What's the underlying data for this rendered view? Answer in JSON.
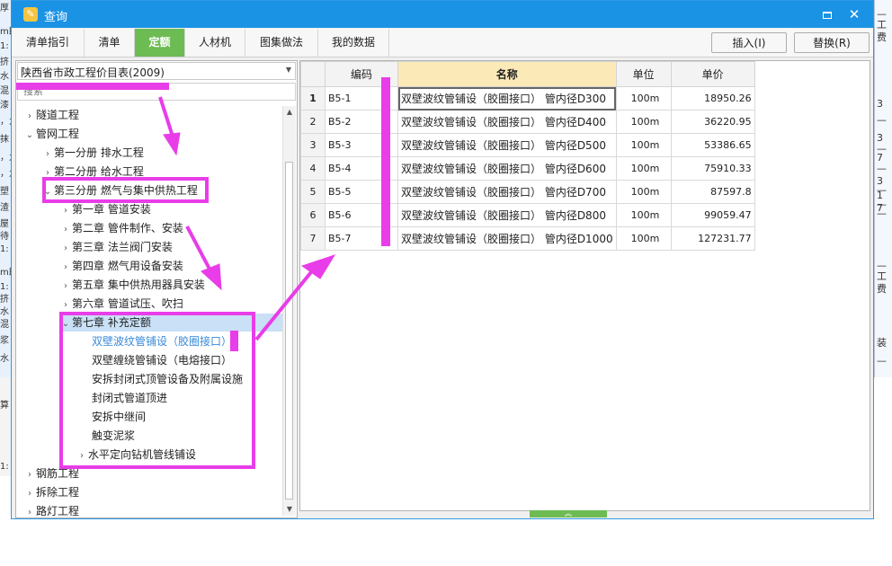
{
  "window": {
    "title": "查询",
    "minimize_label": "",
    "close_label": "✕"
  },
  "tabs": [
    {
      "label": "清单指引",
      "active": false
    },
    {
      "label": "清单",
      "active": false
    },
    {
      "label": "定额",
      "active": true
    },
    {
      "label": "人材机",
      "active": false
    },
    {
      "label": "图集做法",
      "active": false
    },
    {
      "label": "我的数据",
      "active": false
    }
  ],
  "actions": {
    "insert_label": "插入(I)",
    "replace_label": "替换(R)"
  },
  "library": {
    "selected": "陕西省市政工程价目表(2009)"
  },
  "search": {
    "placeholder": "搜索"
  },
  "tree": [
    {
      "label": "隧道工程",
      "chevron": "›"
    },
    {
      "label": "管网工程",
      "chevron": "⌄"
    },
    {
      "label": "第一分册  排水工程",
      "chevron": "›"
    },
    {
      "label": "第二分册  给水工程",
      "chevron": "›"
    },
    {
      "label": "第三分册  燃气与集中供热工程",
      "chevron": "⌄"
    },
    {
      "label": "第一章  管道安装",
      "chevron": "›"
    },
    {
      "label": "第二章  管件制作、安装",
      "chevron": "›"
    },
    {
      "label": "第三章  法兰阀门安装",
      "chevron": "›"
    },
    {
      "label": "第四章  燃气用设备安装",
      "chevron": "›"
    },
    {
      "label": "第五章  集中供热用器具安装",
      "chevron": "›"
    },
    {
      "label": "第六章  管道试压、吹扫",
      "chevron": "›"
    },
    {
      "label": "第七章  补充定额",
      "chevron": "⌄"
    },
    {
      "label": "双壁波纹管铺设（胶圈接口）",
      "chevron": ""
    },
    {
      "label": "双壁缠绕管铺设（电熔接口）",
      "chevron": ""
    },
    {
      "label": "安拆封闭式顶管设备及附属设施",
      "chevron": ""
    },
    {
      "label": "封闭式管道顶进",
      "chevron": ""
    },
    {
      "label": "安拆中继间",
      "chevron": ""
    },
    {
      "label": "触变泥浆",
      "chevron": ""
    },
    {
      "label": "水平定向钻机管线铺设",
      "chevron": "›"
    },
    {
      "label": "钢筋工程",
      "chevron": "›"
    },
    {
      "label": "拆除工程",
      "chevron": "›"
    },
    {
      "label": "路灯工程",
      "chevron": "›"
    }
  ],
  "grid": {
    "headers": {
      "code": "编码",
      "name": "名称",
      "unit": "单位",
      "price": "单价"
    },
    "rows": [
      {
        "no": "1",
        "code": "B5-1",
        "name": "双壁波纹管铺设（胶圈接口） 管内径D300",
        "unit": "100m",
        "price": "18950.26"
      },
      {
        "no": "2",
        "code": "B5-2",
        "name": "双壁波纹管铺设（胶圈接口） 管内径D400",
        "unit": "100m",
        "price": "36220.95"
      },
      {
        "no": "3",
        "code": "B5-3",
        "name": "双壁波纹管铺设（胶圈接口） 管内径D500",
        "unit": "100m",
        "price": "53386.65"
      },
      {
        "no": "4",
        "code": "B5-4",
        "name": "双壁波纹管铺设（胶圈接口） 管内径D600",
        "unit": "100m",
        "price": "75910.33"
      },
      {
        "no": "5",
        "code": "B5-5",
        "name": "双壁波纹管铺设（胶圈接口） 管内径D700",
        "unit": "100m",
        "price": "87597.8"
      },
      {
        "no": "6",
        "code": "B5-6",
        "name": "双壁波纹管铺设（胶圈接口） 管内径D800",
        "unit": "100m",
        "price": "99059.47"
      },
      {
        "no": "7",
        "code": "B5-7",
        "name": "双壁波纹管铺设（胶圈接口） 管内径D1000",
        "unit": "100m",
        "price": "127231.77"
      }
    ]
  },
  "background": {
    "left_fragments": [
      "厚",
      "m即",
      "1:",
      "挤",
      "水",
      "混",
      "漆",
      "，九",
      "抹",
      "，九",
      "，九",
      "塑",
      "渣",
      "屋",
      "待",
      "1:",
      "m即",
      "1:",
      "挤",
      "水",
      "混",
      "浆",
      "水"
    ],
    "right_fragments": [
      "—",
      "工",
      "费",
      "3",
      "—",
      "3",
      "—",
      "7",
      "—",
      "3",
      "—",
      "1",
      "—",
      "7",
      "—",
      "—",
      "工",
      "费",
      "装",
      "—"
    ],
    "bottom_fragments": [
      "算",
      "1:"
    ]
  },
  "colors": {
    "titlebar": "#1b93e4",
    "active_tab": "#6dbb53",
    "header_highlight": "#fce9b8",
    "annotation": "#e83de8"
  },
  "icons": {
    "app": "app-logo-icon",
    "minimize": "minimize-icon",
    "maximize": "maximize-icon",
    "close": "close-icon"
  }
}
